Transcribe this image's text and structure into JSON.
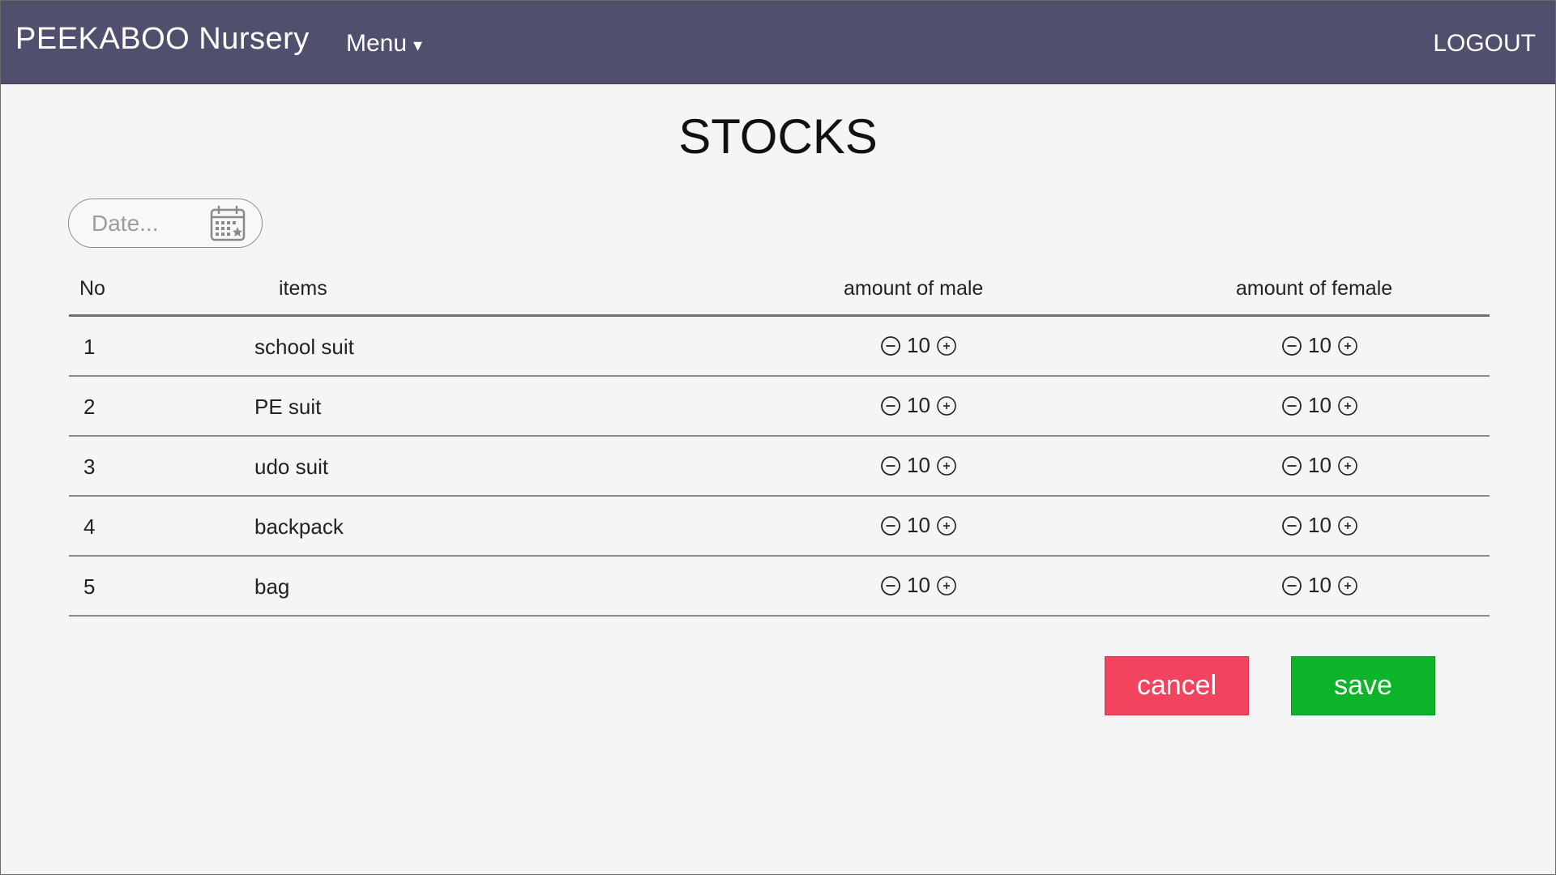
{
  "nav": {
    "brand": "PEEKABOO Nursery",
    "menu_label": "Menu",
    "menu_caret": "▾",
    "logout_label": "LOGOUT"
  },
  "page": {
    "title": "STOCKS"
  },
  "date_filter": {
    "placeholder": "Date...",
    "icon": "calendar-icon"
  },
  "table": {
    "headers": {
      "no": "No",
      "items": "items",
      "male": "amount of male",
      "female": "amount of female"
    },
    "rows": [
      {
        "no": "1",
        "item": "school suit",
        "male": "10",
        "female": "10"
      },
      {
        "no": "2",
        "item": "PE suit",
        "male": "10",
        "female": "10"
      },
      {
        "no": "3",
        "item": "udo suit",
        "male": "10",
        "female": "10"
      },
      {
        "no": "4",
        "item": "backpack",
        "male": "10",
        "female": "10"
      },
      {
        "no": "5",
        "item": "bag",
        "male": "10",
        "female": "10"
      }
    ]
  },
  "actions": {
    "cancel_label": "cancel",
    "save_label": "save"
  },
  "colors": {
    "navbar": "#50506e",
    "cancel": "#f2435f",
    "save": "#0db42a"
  }
}
